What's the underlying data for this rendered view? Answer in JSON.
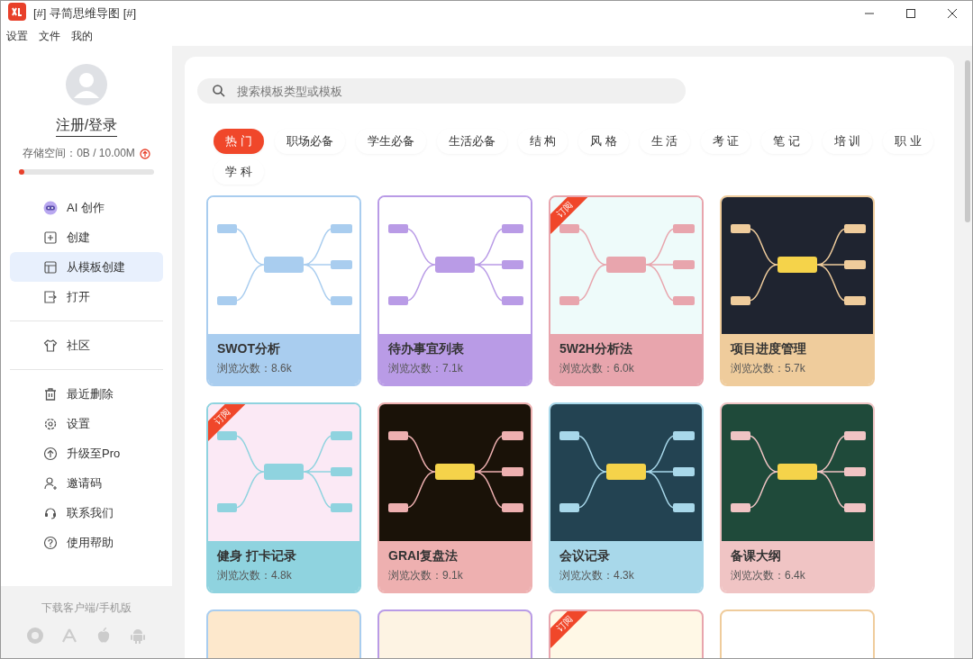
{
  "window": {
    "title": "[#] 寻简思维导图 [#]"
  },
  "menu": [
    "设置",
    "文件",
    "我的"
  ],
  "profile": {
    "login": "注册/登录",
    "storage": "存储空间：0B / 10.00M",
    "level": 0.02
  },
  "nav": [
    {
      "label": "AI 创作",
      "kind": "ai",
      "selected": false
    },
    {
      "label": "创建",
      "kind": "plus",
      "selected": false
    },
    {
      "label": "从模板创建",
      "kind": "template",
      "selected": true
    },
    {
      "label": "打开",
      "kind": "open",
      "selected": false
    }
  ],
  "nav2": [
    {
      "label": "社区",
      "kind": "shirt"
    }
  ],
  "nav3": [
    {
      "label": "最近删除",
      "kind": "trash"
    },
    {
      "label": "设置",
      "kind": "gear"
    },
    {
      "label": "升级至Pro",
      "kind": "up"
    },
    {
      "label": "邀请码",
      "kind": "user"
    },
    {
      "label": "联系我们",
      "kind": "headset"
    },
    {
      "label": "使用帮助",
      "kind": "help"
    }
  ],
  "download": {
    "label": "下载客户端/手机版"
  },
  "search": {
    "placeholder": "搜索模板类型或模板"
  },
  "categories": [
    {
      "label": "热 门",
      "selected": true
    },
    {
      "label": "职场必备",
      "selected": false
    },
    {
      "label": "学生必备",
      "selected": false
    },
    {
      "label": "生活必备",
      "selected": false
    },
    {
      "label": "结 构",
      "selected": false
    },
    {
      "label": "风 格",
      "selected": false
    },
    {
      "label": "生 活",
      "selected": false
    },
    {
      "label": "考 证",
      "selected": false
    },
    {
      "label": "笔 记",
      "selected": false
    },
    {
      "label": "培 训",
      "selected": false
    },
    {
      "label": "职 业",
      "selected": false
    },
    {
      "label": "学 科",
      "selected": false
    }
  ],
  "templates": [
    {
      "title": "SWOT分析",
      "views": "浏览次数：8.6k",
      "color": "#a9cdef"
    },
    {
      "title": "待办事宜列表",
      "views": "浏览次数：7.1k",
      "color": "#b99be6"
    },
    {
      "title": "5W2H分析法",
      "views": "浏览次数：6.0k",
      "color": "#e8a5ad",
      "ribbon": "订阅"
    },
    {
      "title": "项目进度管理",
      "views": "浏览次数：5.7k",
      "color": "#efcc9c"
    },
    {
      "title": "健身 打卡记录",
      "views": "浏览次数：4.8k",
      "color": "#8fd3df",
      "ribbon": "订阅"
    },
    {
      "title": "GRAI复盘法",
      "views": "浏览次数：9.1k",
      "color": "#eeb0b0"
    },
    {
      "title": "会议记录",
      "views": "浏览次数：4.3k",
      "color": "#a8d8ea"
    },
    {
      "title": "备课大纲",
      "views": "浏览次数：6.4k",
      "color": "#f0c4c4"
    }
  ],
  "more_templates": [
    {
      "color": "#a9cdef"
    },
    {
      "color": "#b99be6"
    },
    {
      "color": "#e8a5ad",
      "ribbon": "订阅"
    },
    {
      "color": "#efcc9c"
    }
  ]
}
